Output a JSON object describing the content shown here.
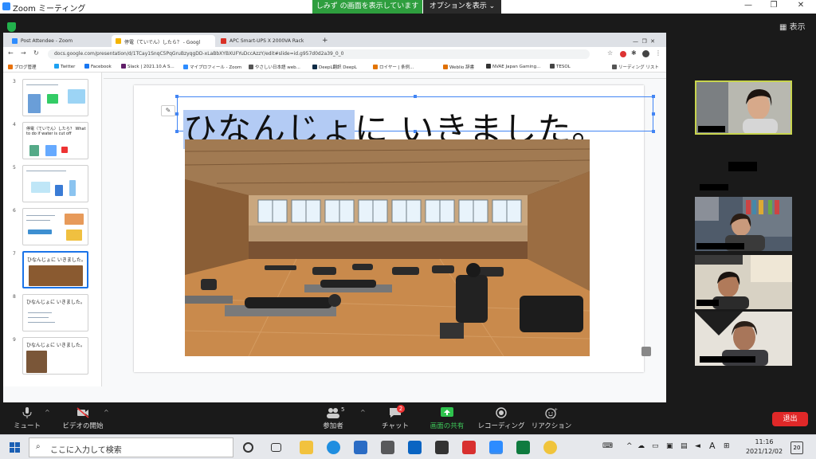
{
  "zoom": {
    "app_title": "Zoom ミーティング",
    "share_banner": "しみず の画面を表示しています",
    "options_button": "オプションを表示 ⌄",
    "view_button": "表示",
    "leave_button": "退出"
  },
  "browser": {
    "tabs": [
      {
        "label": "Post Attendee - Zoom",
        "color": "#2d8cff"
      },
      {
        "label": "停電（ていでん）したら？ - Googl",
        "color": "#f4b400"
      },
      {
        "label": "APC Smart-UPS X 2000VA Rack",
        "color": "#d93025"
      }
    ],
    "url": "docs.google.com/presentation/d/1TCay1SnqC5PqGruBzyqgDD-xLaBbXYBXUFYuDccAzzY/edit#slide=id.g957d0d2a39_0_0",
    "bookmarks": [
      {
        "label": "ブログ管理",
        "color": "#e8710a"
      },
      {
        "label": "Twitter",
        "color": "#1da1f2"
      },
      {
        "label": "Facebook",
        "color": "#1877f2"
      },
      {
        "label": "Slack | 2021.10.A S...",
        "color": "#611f69"
      },
      {
        "label": "マイプロフィール - Zoom",
        "color": "#2d8cff"
      },
      {
        "label": "やさしい日本語 web...",
        "color": "#555555"
      },
      {
        "label": "DeepL翻訳 DeepL",
        "color": "#0f2b46"
      },
      {
        "label": "ロイヤー | 条例...",
        "color": "#e37400"
      },
      {
        "label": "Weblio 辞書",
        "color": "#e07000"
      },
      {
        "label": "NVAE Japan Gaming...",
        "color": "#333333"
      },
      {
        "label": "TESOL",
        "color": "#444444"
      },
      {
        "label": "リーディング リスト",
        "color": "#555555"
      }
    ]
  },
  "slides": {
    "thumbnails": [
      {
        "num": "3",
        "title": ""
      },
      {
        "num": "4",
        "title": "停電（ていでん）したら？ What to do if water is cut off"
      },
      {
        "num": "5",
        "title": ""
      },
      {
        "num": "6",
        "title": ""
      },
      {
        "num": "7",
        "title": "ひなんじょに いきました。"
      },
      {
        "num": "8",
        "title": "ひなんじょに いきました。"
      },
      {
        "num": "9",
        "title": "ひなんじょに いきました。"
      }
    ],
    "title_selected": "ひなんじょ",
    "title_rest": "に いきました。"
  },
  "toolbar": {
    "mute": "ミュート",
    "video": "ビデオの開始",
    "participants": "参加者",
    "participants_count": "5",
    "chat": "チャット",
    "chat_badge": "2",
    "share": "画面の共有",
    "record": "レコーディング",
    "reactions": "リアクション"
  },
  "taskbar": {
    "search_placeholder": "ここに入力して検索",
    "time": "11:16",
    "date": "2021/12/02",
    "notifications": "20",
    "ime": "A"
  }
}
